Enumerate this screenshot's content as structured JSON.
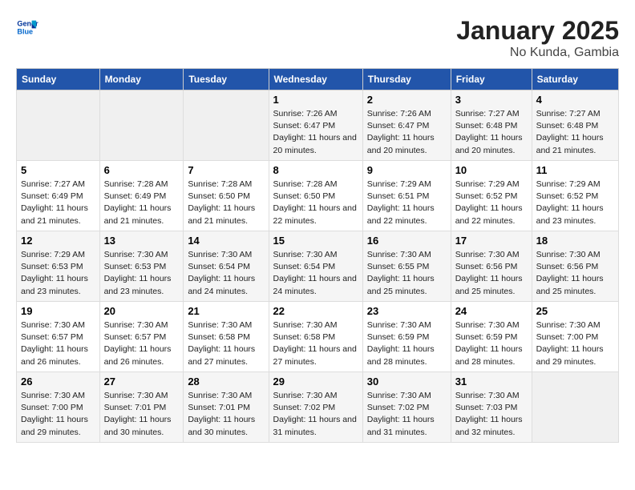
{
  "logo": {
    "line1": "General",
    "line2": "Blue"
  },
  "title": "January 2025",
  "subtitle": "No Kunda, Gambia",
  "headers": [
    "Sunday",
    "Monday",
    "Tuesday",
    "Wednesday",
    "Thursday",
    "Friday",
    "Saturday"
  ],
  "weeks": [
    [
      {
        "num": "",
        "sunrise": "",
        "sunset": "",
        "daylight": ""
      },
      {
        "num": "",
        "sunrise": "",
        "sunset": "",
        "daylight": ""
      },
      {
        "num": "",
        "sunrise": "",
        "sunset": "",
        "daylight": ""
      },
      {
        "num": "1",
        "sunrise": "Sunrise: 7:26 AM",
        "sunset": "Sunset: 6:47 PM",
        "daylight": "Daylight: 11 hours and 20 minutes."
      },
      {
        "num": "2",
        "sunrise": "Sunrise: 7:26 AM",
        "sunset": "Sunset: 6:47 PM",
        "daylight": "Daylight: 11 hours and 20 minutes."
      },
      {
        "num": "3",
        "sunrise": "Sunrise: 7:27 AM",
        "sunset": "Sunset: 6:48 PM",
        "daylight": "Daylight: 11 hours and 20 minutes."
      },
      {
        "num": "4",
        "sunrise": "Sunrise: 7:27 AM",
        "sunset": "Sunset: 6:48 PM",
        "daylight": "Daylight: 11 hours and 21 minutes."
      }
    ],
    [
      {
        "num": "5",
        "sunrise": "Sunrise: 7:27 AM",
        "sunset": "Sunset: 6:49 PM",
        "daylight": "Daylight: 11 hours and 21 minutes."
      },
      {
        "num": "6",
        "sunrise": "Sunrise: 7:28 AM",
        "sunset": "Sunset: 6:49 PM",
        "daylight": "Daylight: 11 hours and 21 minutes."
      },
      {
        "num": "7",
        "sunrise": "Sunrise: 7:28 AM",
        "sunset": "Sunset: 6:50 PM",
        "daylight": "Daylight: 11 hours and 21 minutes."
      },
      {
        "num": "8",
        "sunrise": "Sunrise: 7:28 AM",
        "sunset": "Sunset: 6:50 PM",
        "daylight": "Daylight: 11 hours and 22 minutes."
      },
      {
        "num": "9",
        "sunrise": "Sunrise: 7:29 AM",
        "sunset": "Sunset: 6:51 PM",
        "daylight": "Daylight: 11 hours and 22 minutes."
      },
      {
        "num": "10",
        "sunrise": "Sunrise: 7:29 AM",
        "sunset": "Sunset: 6:52 PM",
        "daylight": "Daylight: 11 hours and 22 minutes."
      },
      {
        "num": "11",
        "sunrise": "Sunrise: 7:29 AM",
        "sunset": "Sunset: 6:52 PM",
        "daylight": "Daylight: 11 hours and 23 minutes."
      }
    ],
    [
      {
        "num": "12",
        "sunrise": "Sunrise: 7:29 AM",
        "sunset": "Sunset: 6:53 PM",
        "daylight": "Daylight: 11 hours and 23 minutes."
      },
      {
        "num": "13",
        "sunrise": "Sunrise: 7:30 AM",
        "sunset": "Sunset: 6:53 PM",
        "daylight": "Daylight: 11 hours and 23 minutes."
      },
      {
        "num": "14",
        "sunrise": "Sunrise: 7:30 AM",
        "sunset": "Sunset: 6:54 PM",
        "daylight": "Daylight: 11 hours and 24 minutes."
      },
      {
        "num": "15",
        "sunrise": "Sunrise: 7:30 AM",
        "sunset": "Sunset: 6:54 PM",
        "daylight": "Daylight: 11 hours and 24 minutes."
      },
      {
        "num": "16",
        "sunrise": "Sunrise: 7:30 AM",
        "sunset": "Sunset: 6:55 PM",
        "daylight": "Daylight: 11 hours and 25 minutes."
      },
      {
        "num": "17",
        "sunrise": "Sunrise: 7:30 AM",
        "sunset": "Sunset: 6:56 PM",
        "daylight": "Daylight: 11 hours and 25 minutes."
      },
      {
        "num": "18",
        "sunrise": "Sunrise: 7:30 AM",
        "sunset": "Sunset: 6:56 PM",
        "daylight": "Daylight: 11 hours and 25 minutes."
      }
    ],
    [
      {
        "num": "19",
        "sunrise": "Sunrise: 7:30 AM",
        "sunset": "Sunset: 6:57 PM",
        "daylight": "Daylight: 11 hours and 26 minutes."
      },
      {
        "num": "20",
        "sunrise": "Sunrise: 7:30 AM",
        "sunset": "Sunset: 6:57 PM",
        "daylight": "Daylight: 11 hours and 26 minutes."
      },
      {
        "num": "21",
        "sunrise": "Sunrise: 7:30 AM",
        "sunset": "Sunset: 6:58 PM",
        "daylight": "Daylight: 11 hours and 27 minutes."
      },
      {
        "num": "22",
        "sunrise": "Sunrise: 7:30 AM",
        "sunset": "Sunset: 6:58 PM",
        "daylight": "Daylight: 11 hours and 27 minutes."
      },
      {
        "num": "23",
        "sunrise": "Sunrise: 7:30 AM",
        "sunset": "Sunset: 6:59 PM",
        "daylight": "Daylight: 11 hours and 28 minutes."
      },
      {
        "num": "24",
        "sunrise": "Sunrise: 7:30 AM",
        "sunset": "Sunset: 6:59 PM",
        "daylight": "Daylight: 11 hours and 28 minutes."
      },
      {
        "num": "25",
        "sunrise": "Sunrise: 7:30 AM",
        "sunset": "Sunset: 7:00 PM",
        "daylight": "Daylight: 11 hours and 29 minutes."
      }
    ],
    [
      {
        "num": "26",
        "sunrise": "Sunrise: 7:30 AM",
        "sunset": "Sunset: 7:00 PM",
        "daylight": "Daylight: 11 hours and 29 minutes."
      },
      {
        "num": "27",
        "sunrise": "Sunrise: 7:30 AM",
        "sunset": "Sunset: 7:01 PM",
        "daylight": "Daylight: 11 hours and 30 minutes."
      },
      {
        "num": "28",
        "sunrise": "Sunrise: 7:30 AM",
        "sunset": "Sunset: 7:01 PM",
        "daylight": "Daylight: 11 hours and 30 minutes."
      },
      {
        "num": "29",
        "sunrise": "Sunrise: 7:30 AM",
        "sunset": "Sunset: 7:02 PM",
        "daylight": "Daylight: 11 hours and 31 minutes."
      },
      {
        "num": "30",
        "sunrise": "Sunrise: 7:30 AM",
        "sunset": "Sunset: 7:02 PM",
        "daylight": "Daylight: 11 hours and 31 minutes."
      },
      {
        "num": "31",
        "sunrise": "Sunrise: 7:30 AM",
        "sunset": "Sunset: 7:03 PM",
        "daylight": "Daylight: 11 hours and 32 minutes."
      },
      {
        "num": "",
        "sunrise": "",
        "sunset": "",
        "daylight": ""
      }
    ]
  ]
}
